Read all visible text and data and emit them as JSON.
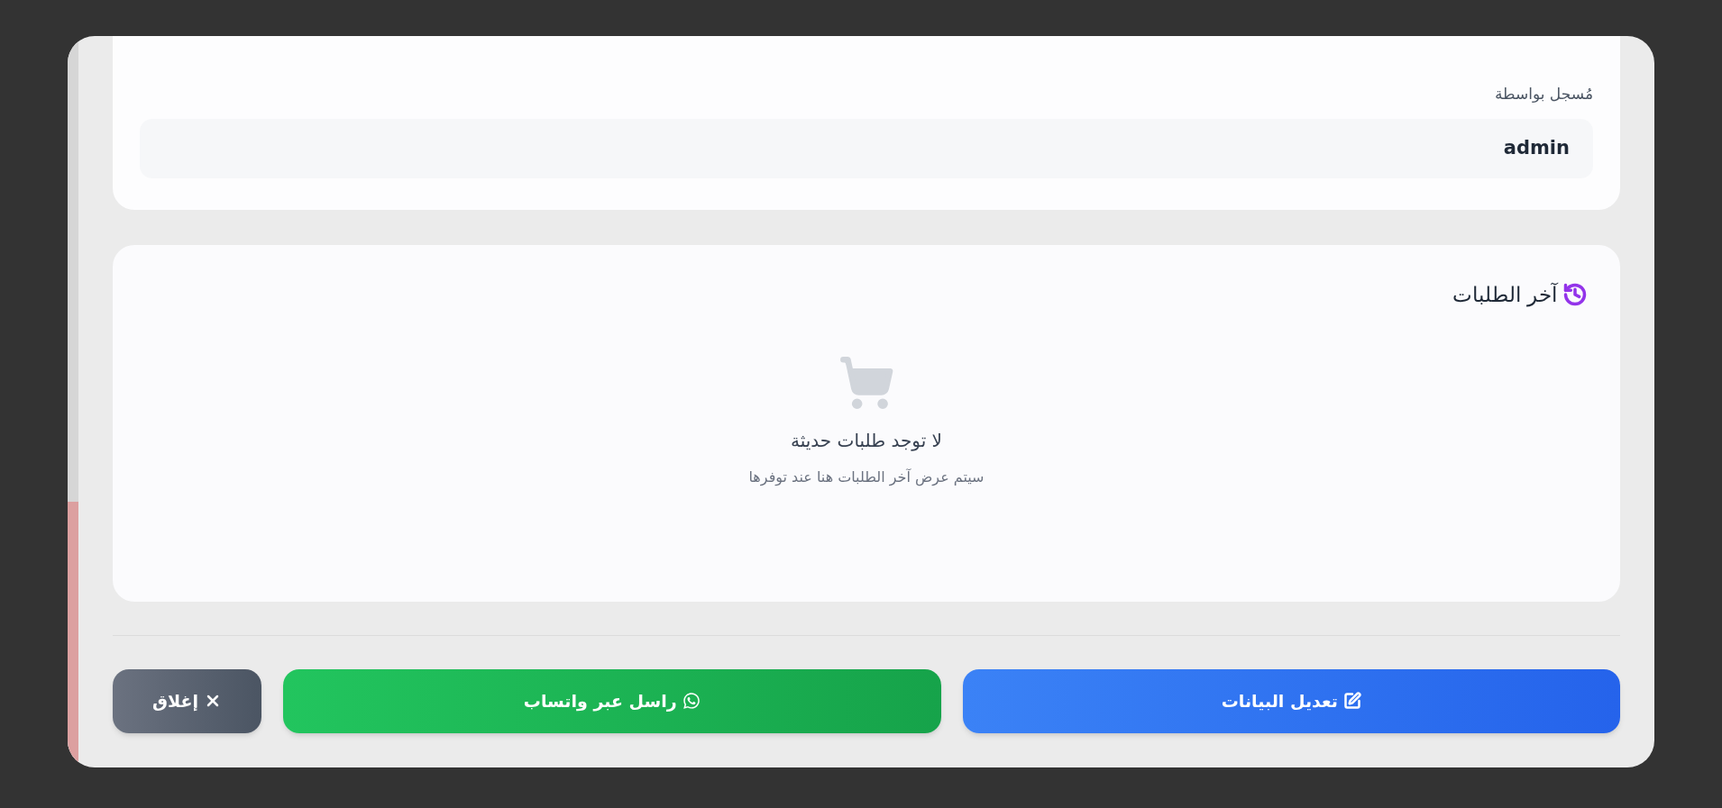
{
  "registered_by": {
    "label": "مُسجل بواسطة",
    "value": "admin"
  },
  "recent_orders": {
    "title": "آخر الطلبات",
    "empty_title": "لا توجد طلبات حديثة",
    "empty_hint": "سيتم عرض آخر الطلبات هنا عند توفرها"
  },
  "buttons": [
    {
      "kind": "edit",
      "label": "تعديل البيانات"
    },
    {
      "kind": "whatsapp",
      "label": "راسل عبر واتساب"
    },
    {
      "kind": "close",
      "label": "إغلاق"
    }
  ]
}
